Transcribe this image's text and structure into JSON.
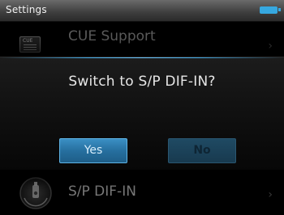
{
  "header": {
    "title": "Settings"
  },
  "list": {
    "items": [
      {
        "label": "CUE Support",
        "icon": "cue-icon"
      },
      {
        "label": "S/P DIF-IN",
        "icon": "spdif-icon"
      }
    ]
  },
  "dialog": {
    "message": "Switch to S/P DIF-IN?",
    "yes_label": "Yes",
    "no_label": "No"
  },
  "colors": {
    "accent": "#36a8e0",
    "selected_button": "#2a7cb4",
    "dialog_background": "#101010"
  }
}
